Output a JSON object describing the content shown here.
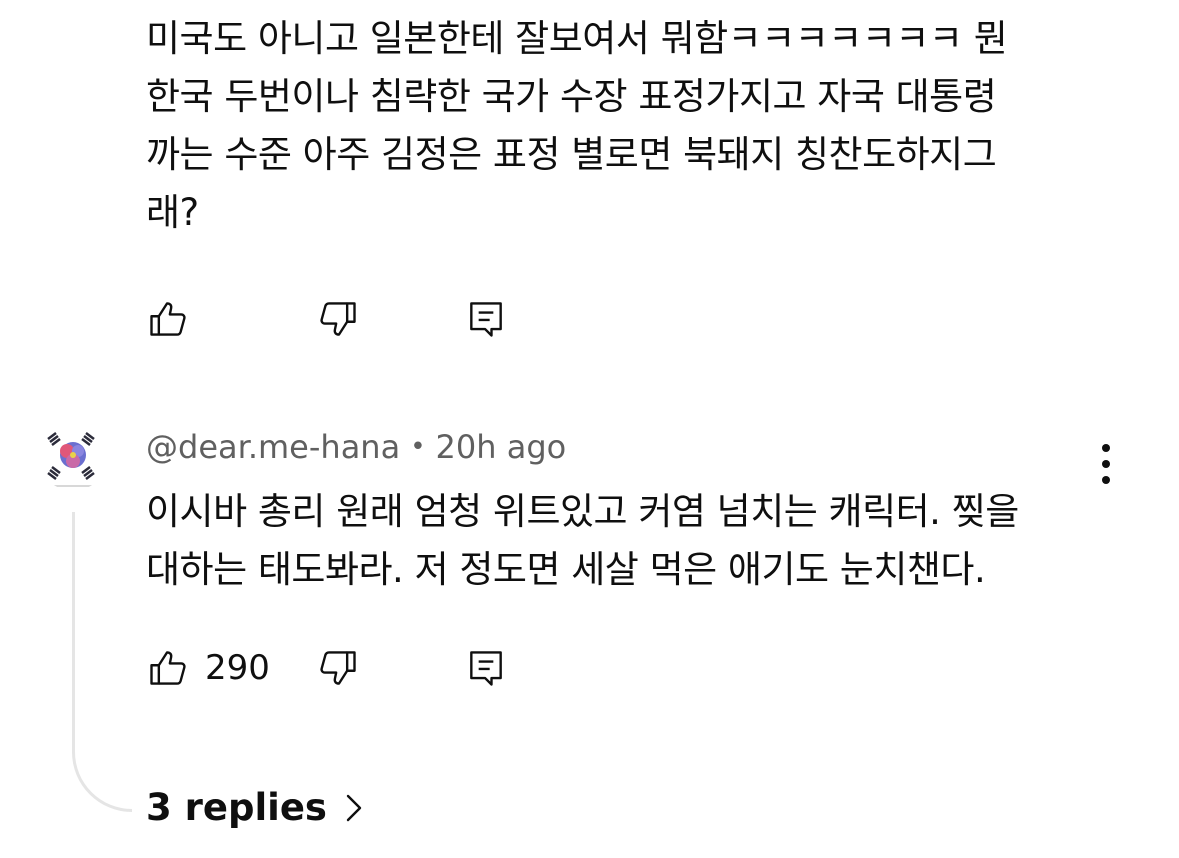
{
  "comment1": {
    "lines": [
      "미국도 아니고 일본한테 잘보여서 뭐함ㅋㅋㅋㅋㅋㅋㅋ 뭔",
      "한국 두번이나 침략한 국가 수장 표정가지고 자국 대통령",
      "까는 수준 아주 김정은 표정 별로면 북돼지 칭찬도하지그",
      "래?"
    ],
    "like_count": "",
    "icons": {
      "like": "thumbs-up-icon",
      "dislike": "thumbs-down-icon",
      "reply": "comment-reply-icon"
    }
  },
  "comment2": {
    "author": "@dear.me-hana",
    "separator": "•",
    "time": "20h ago",
    "lines": [
      "이시바 총리 원래 엄청 위트있고 커염 넘치는 캐릭터. 찢을",
      "대하는 태도봐라. 저 정도면 세살 먹은 애기도 눈치챈다."
    ],
    "like_count": "290",
    "replies_label": "3 replies",
    "icons": {
      "avatar": "avatar-flag-icon",
      "more": "more-vertical-icon",
      "like": "thumbs-up-icon",
      "dislike": "thumbs-down-icon",
      "reply": "comment-reply-icon",
      "chevron": "chevron-right-icon"
    }
  },
  "colors": {
    "text_primary": "#0f0f0f",
    "text_secondary": "#606060",
    "thread_line": "#e5e5e5"
  }
}
